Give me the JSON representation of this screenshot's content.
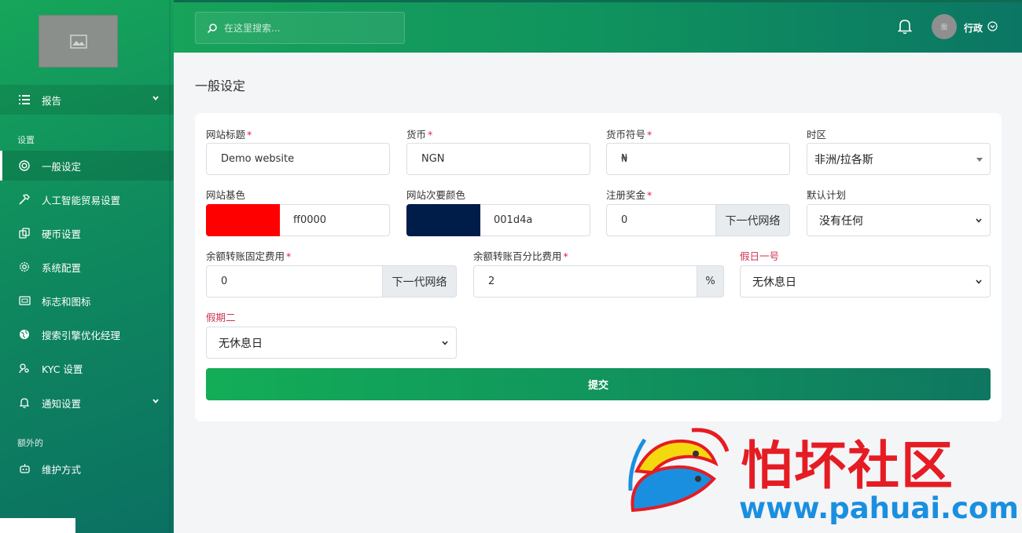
{
  "header": {
    "search_placeholder": "在这里搜索...",
    "user_name": "行政",
    "avatar_text": "图"
  },
  "sidebar": {
    "items": [
      {
        "label": "报告",
        "icon": "list-icon",
        "has_chevron": true
      },
      {
        "label": "一般设定",
        "icon": "target-icon",
        "active": true
      },
      {
        "label": "人工智能贸易设置",
        "icon": "hammer-icon"
      },
      {
        "label": "硬币设置",
        "icon": "coins-icon"
      },
      {
        "label": "系统配置",
        "icon": "gear-icon"
      },
      {
        "label": "标志和图标",
        "icon": "image-icon"
      },
      {
        "label": "搜索引擎优化经理",
        "icon": "globe-icon"
      },
      {
        "label": "KYC 设置",
        "icon": "user-key-icon"
      },
      {
        "label": "通知设置",
        "icon": "bell-icon",
        "has_chevron": true
      },
      {
        "label": "维护方式",
        "icon": "robot-icon"
      }
    ],
    "section_settings": "设置",
    "section_extra": "额外的"
  },
  "main": {
    "title": "一般设定",
    "fields": {
      "site_title": {
        "label": "网站标题",
        "value": "Demo website"
      },
      "currency": {
        "label": "货币",
        "value": "NGN"
      },
      "currency_symbol": {
        "label": "货币符号",
        "value": "₦"
      },
      "timezone": {
        "label": "时区",
        "value": "非洲/拉各斯"
      },
      "base_color": {
        "label": "网站基色",
        "value": "ff0000",
        "swatch": "#ff0000"
      },
      "secondary_color": {
        "label": "网站次要颜色",
        "value": "001d4a",
        "swatch": "#001d4a"
      },
      "signup_bonus": {
        "label": "注册奖金",
        "value": "0",
        "addon": "下一代网络"
      },
      "default_plan": {
        "label": "默认计划",
        "value": "没有任何"
      },
      "fixed_fee": {
        "label": "余额转账固定费用",
        "value": "0",
        "addon": "下一代网络"
      },
      "percent_fee": {
        "label": "余额转账百分比费用",
        "value": "2",
        "addon": "%"
      },
      "holiday_one": {
        "label": "假日一号",
        "value": "无休息日"
      },
      "holiday_two": {
        "label": "假期二",
        "value": "无休息日"
      }
    },
    "submit_label": "提交"
  },
  "watermark": {
    "text": "怕坏社区",
    "url": "www.pahuai.com"
  }
}
